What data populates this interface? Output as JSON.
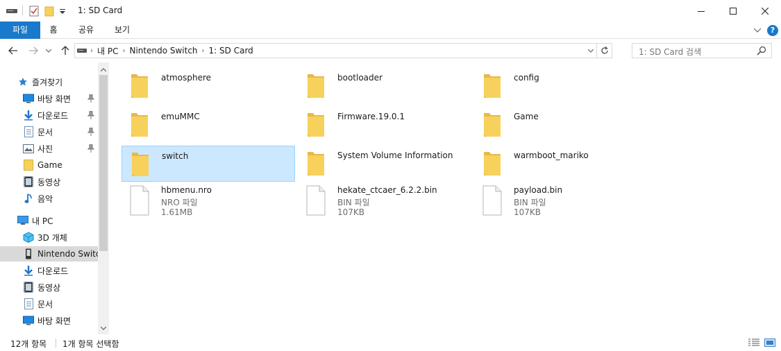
{
  "window": {
    "title": "1: SD Card",
    "controls": [
      "minimize-icon",
      "maximize-icon",
      "close-icon"
    ]
  },
  "ribbon": {
    "tabs": [
      "파일",
      "홈",
      "공유",
      "보기"
    ],
    "help_label": "?"
  },
  "address": {
    "crumbs": [
      "내 PC",
      "Nintendo Switch",
      "1: SD Card"
    ]
  },
  "search": {
    "placeholder": "1: SD Card 검색"
  },
  "nav": {
    "items": [
      {
        "label": "즐겨찾기",
        "icon": "star-icon",
        "pinned": false
      },
      {
        "label": "바탕 화면",
        "icon": "desktop-icon",
        "pinned": true
      },
      {
        "label": "다운로드",
        "icon": "download-icon",
        "pinned": true
      },
      {
        "label": "문서",
        "icon": "document-icon",
        "pinned": true
      },
      {
        "label": "사진",
        "icon": "picture-icon",
        "pinned": true
      },
      {
        "label": "Game",
        "icon": "folder-icon",
        "pinned": false
      },
      {
        "label": "동영상",
        "icon": "video-icon",
        "pinned": false
      },
      {
        "label": "음악",
        "icon": "music-icon",
        "pinned": false
      },
      {
        "label": "내 PC",
        "icon": "computer-icon",
        "pinned": false
      },
      {
        "label": "3D 개체",
        "icon": "cube-icon",
        "pinned": false
      },
      {
        "label": "Nintendo Switch",
        "icon": "device-icon",
        "pinned": false,
        "selected": true
      },
      {
        "label": "다운로드",
        "icon": "download-icon",
        "pinned": false
      },
      {
        "label": "동영상",
        "icon": "video-icon",
        "pinned": false
      },
      {
        "label": "문서",
        "icon": "document-icon",
        "pinned": false
      },
      {
        "label": "바탕 화면",
        "icon": "desktop-icon",
        "pinned": false
      }
    ]
  },
  "files": [
    {
      "name": "atmosphere",
      "kind": "folder"
    },
    {
      "name": "bootloader",
      "kind": "folder"
    },
    {
      "name": "config",
      "kind": "folder"
    },
    {
      "name": "emuMMC",
      "kind": "folder"
    },
    {
      "name": "Firmware.19.0.1",
      "kind": "folder"
    },
    {
      "name": "Game",
      "kind": "folder"
    },
    {
      "name": "switch",
      "kind": "folder",
      "selected": true
    },
    {
      "name": "System Volume Information",
      "kind": "folder"
    },
    {
      "name": "warmboot_mariko",
      "kind": "folder"
    },
    {
      "name": "hbmenu.nro",
      "kind": "file",
      "type": "NRO 파일",
      "size": "1.61MB"
    },
    {
      "name": "hekate_ctcaer_6.2.2.bin",
      "kind": "file",
      "type": "BIN 파일",
      "size": "107KB"
    },
    {
      "name": "payload.bin",
      "kind": "file",
      "type": "BIN 파일",
      "size": "107KB"
    }
  ],
  "status": {
    "item_count": "12개 항목",
    "selection": "1개 항목 선택함"
  },
  "colors": {
    "accent": "#1979ca",
    "selection_bg": "#cce8ff",
    "selection_border": "#99d1ff",
    "folder": "#f7d15c"
  }
}
